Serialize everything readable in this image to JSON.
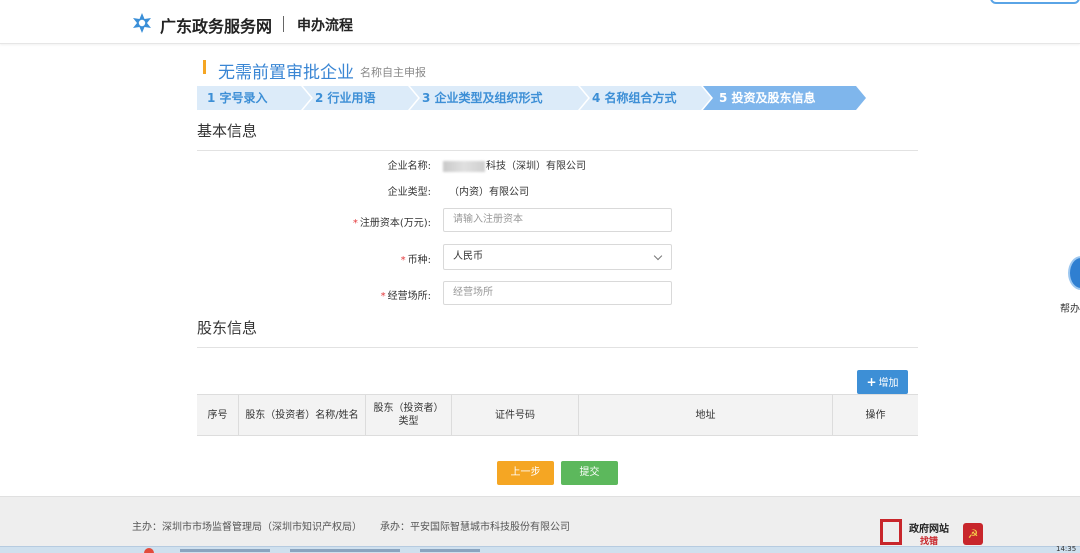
{
  "header": {
    "site_name": "广东政务服务网",
    "section": "申办流程"
  },
  "page": {
    "title": "无需前置审批企业",
    "subtitle": "名称自主申报"
  },
  "steps": [
    {
      "label": "1 字号录入",
      "active": false
    },
    {
      "label": "2 行业用语",
      "active": false
    },
    {
      "label": "3 企业类型及组织形式",
      "active": false
    },
    {
      "label": "4 名称组合方式",
      "active": false
    },
    {
      "label": "5 投资及股东信息",
      "active": true
    }
  ],
  "basic_info": {
    "heading": "基本信息",
    "company_name_label": "企业名称:",
    "company_name_value": "科技（深圳）有限公司",
    "company_type_label": "企业类型:",
    "company_type_value": "（内资）有限公司",
    "capital_label": "注册资本(万元):",
    "capital_placeholder": "请输入注册资本",
    "currency_label": "币种:",
    "currency_value": "人民币",
    "place_label": "经营场所:",
    "place_placeholder": "经营场所",
    "required_mark": "*"
  },
  "shareholder_info": {
    "heading": "股东信息",
    "add_label": "增加",
    "add_icon": "plus-icon",
    "columns": [
      "序号",
      "股东（投资者）名称/姓名",
      "股东（投资者）类型",
      "证件号码",
      "地址",
      "操作"
    ]
  },
  "actions": {
    "prev_label": "上一步",
    "submit_label": "提交"
  },
  "footer": {
    "host": "主办：深圳市市场监督管理局（深圳市知识产权局）",
    "contractor": "承办：平安国际智慧城市科技股份有限公司",
    "gov_badge_title": "政府网站",
    "gov_badge_sub": "找错"
  },
  "help": {
    "label": "帮办"
  },
  "taskbar": {
    "clock": "14:35"
  },
  "colors": {
    "accent": "#3d8fd6",
    "step_active": "#7fb6ec",
    "step_inactive": "#dcebf9",
    "prev_button": "#f5a623",
    "submit_button": "#5cb85c",
    "required": "#e4393c"
  }
}
